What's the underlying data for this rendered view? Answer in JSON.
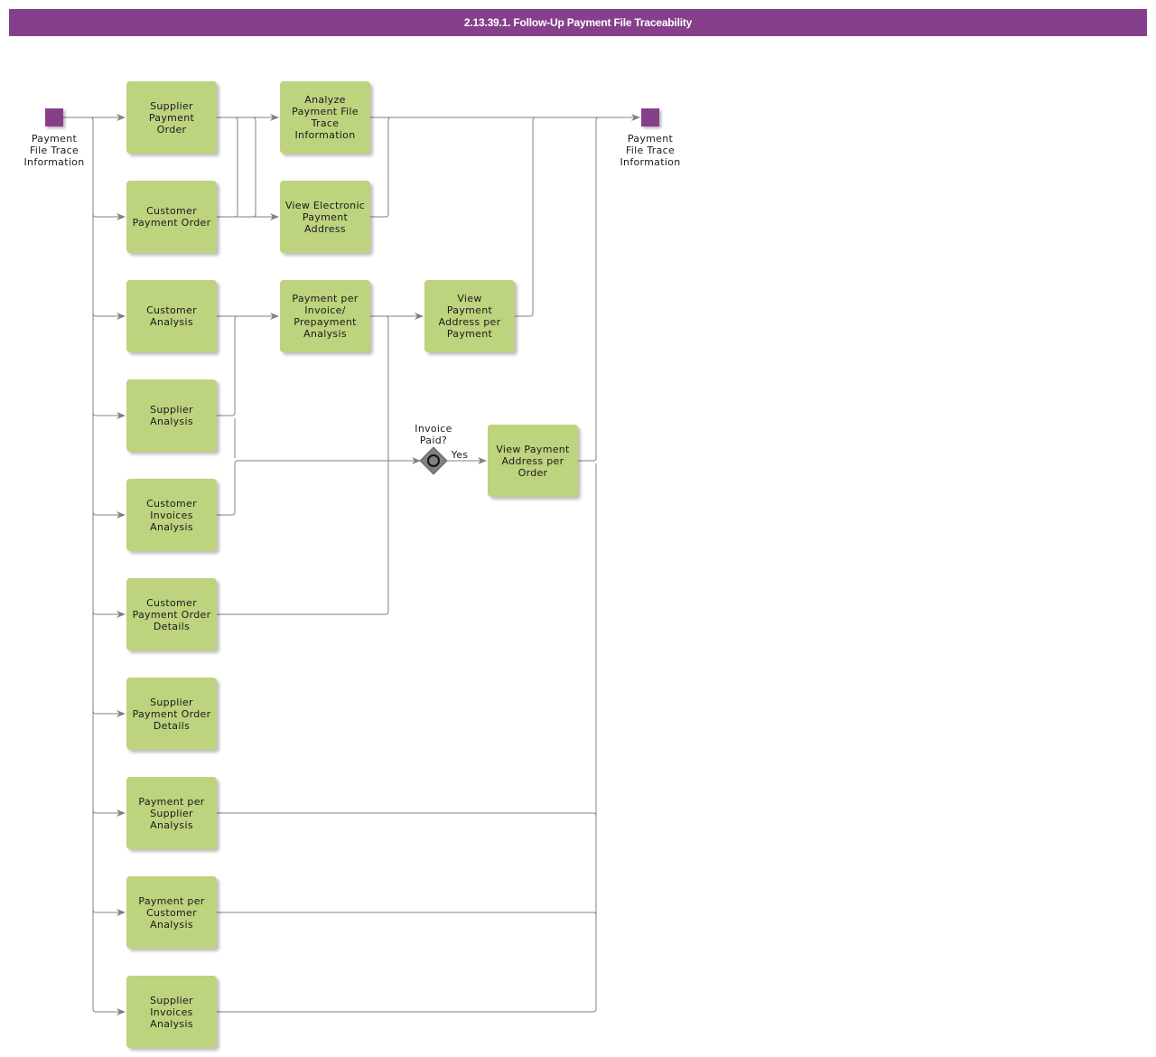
{
  "header": {
    "title": "2.13.39.1. Follow-Up Payment File Traceability"
  },
  "colors": {
    "header": "#86408b",
    "task": "#bdd37e",
    "event": "#86408b",
    "gateway": "#808080",
    "edge": "#808080"
  },
  "start_event": {
    "label": "Payment\nFile Trace\nInformation",
    "icon": "start-event-square"
  },
  "end_event": {
    "label": "Payment\nFile Trace\nInformation",
    "icon": "end-event-square"
  },
  "gateway": {
    "label": "Invoice\nPaid?",
    "icon": "inclusive-gateway-diamond",
    "yes_label": "Yes"
  },
  "tasks": {
    "supplier_payment_order": "Supplier\nPayment\nOrder",
    "customer_payment_order": "Customer\nPayment Order",
    "customer_analysis": "Customer\nAnalysis",
    "supplier_analysis": "Supplier\nAnalysis",
    "customer_invoices_analysis": "Customer\nInvoices\nAnalysis",
    "customer_payment_order_details": "Customer\nPayment Order\nDetails",
    "supplier_payment_order_details": "Supplier\nPayment Order\nDetails",
    "payment_per_supplier_analysis": "Payment per\nSupplier\nAnalysis",
    "payment_per_customer_analysis": "Payment per\nCustomer\nAnalysis",
    "supplier_invoices_analysis": "Supplier\nInvoices\nAnalysis",
    "analyze_payment_file_trace_information": "Analyze\nPayment File\nTrace\nInformation",
    "view_electronic_payment_address": "View Electronic\nPayment\nAddress",
    "payment_per_invoice_prepayment_analysis": "Payment per\nInvoice/\nPrepayment\nAnalysis",
    "view_payment_address_per_payment": "View\nPayment\nAddress per\nPayment",
    "view_payment_address_per_order": "View Payment\nAddress per\nOrder"
  }
}
